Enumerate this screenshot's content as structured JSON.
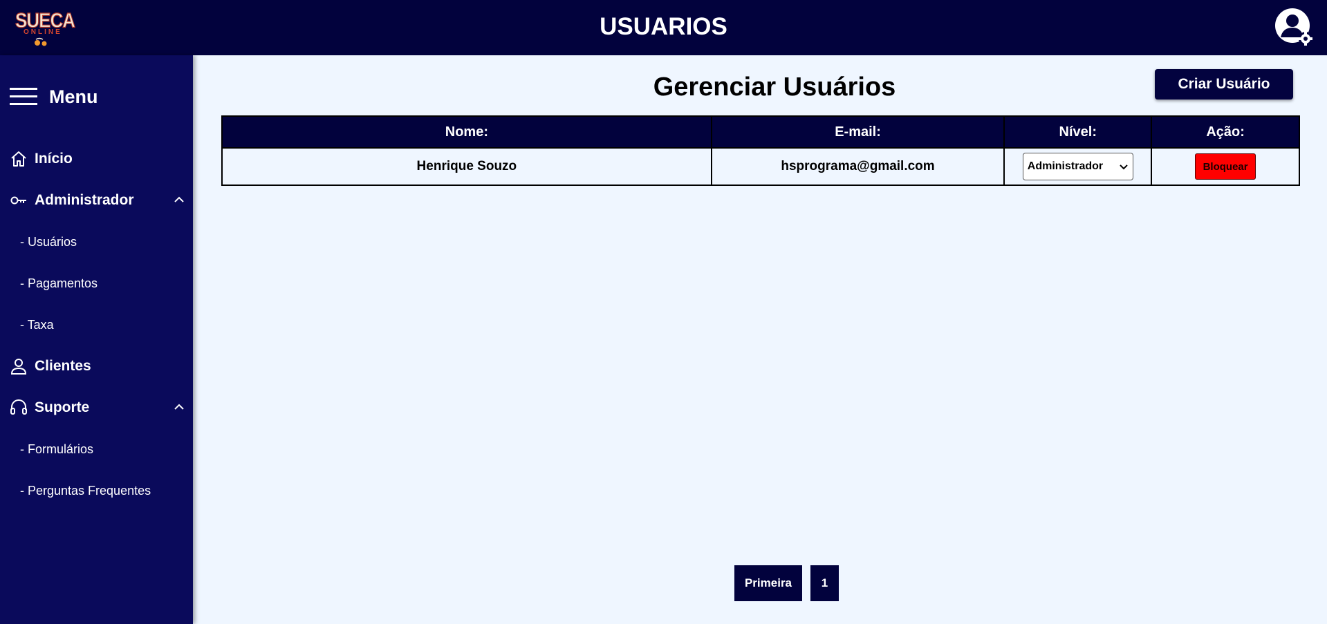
{
  "header": {
    "logo_text": "SUECA",
    "logo_sub": "ONLINE",
    "title": "USUARIOS",
    "avatar_icon": "user-settings-icon"
  },
  "sidebar": {
    "menu_label": "Menu",
    "items": [
      {
        "label": "Início",
        "icon": "home-icon"
      },
      {
        "label": "Administrador",
        "icon": "key-icon",
        "expanded": true,
        "children": [
          "- Usuários",
          "- Pagamentos",
          "- Taxa"
        ]
      },
      {
        "label": "Clientes",
        "icon": "user-icon"
      },
      {
        "label": "Suporte",
        "icon": "headset-icon",
        "expanded": true,
        "children": [
          "- Formulários",
          "- Perguntas Frequentes"
        ]
      }
    ]
  },
  "main": {
    "title": "Gerenciar Usuários",
    "create_button": "Criar Usuário",
    "table": {
      "headers": [
        "Nome:",
        "E-mail:",
        "Nível:",
        "Ação:"
      ],
      "rows": [
        {
          "name": "Henrique Souzo",
          "email": "hsprograma@gmail.com",
          "level": "Administrador",
          "action": "Bloquear"
        }
      ]
    },
    "pagination": {
      "first_label": "Primeira",
      "pages": [
        "1"
      ]
    }
  },
  "colors": {
    "header_bg": "#02023d",
    "sidebar_bg": "#0a0a5b",
    "page_bg": "#eff6ff",
    "danger": "#ff0000"
  }
}
